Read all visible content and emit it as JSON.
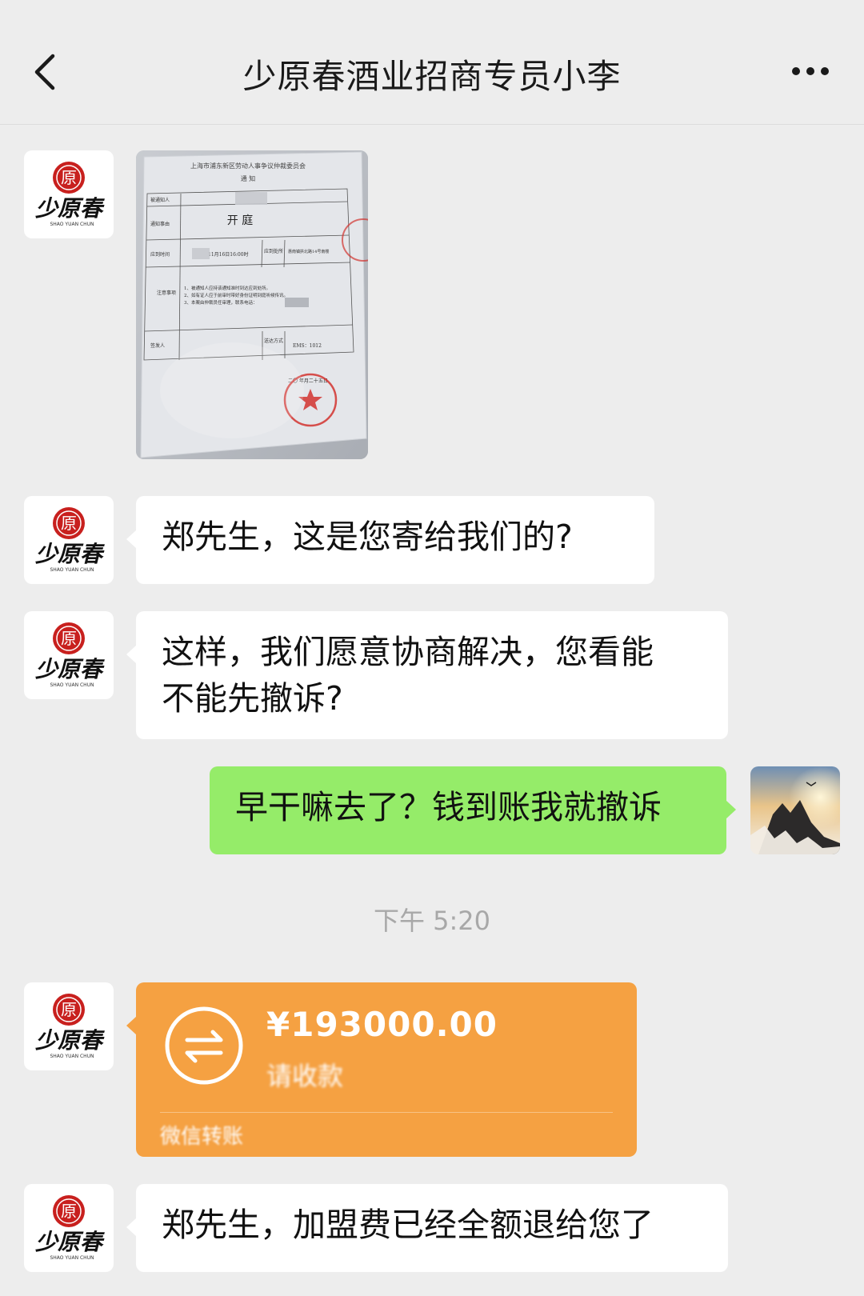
{
  "header": {
    "title": "少原春酒业招商专员小李"
  },
  "contact": {
    "avatar_logo_text": "少原春",
    "avatar_logo_pinyin": "SHAO YUAN CHUN",
    "avatar_seal_char": "原"
  },
  "photo": {
    "doc_title": "上海市浦东新区劳动人事争议仲裁委员会",
    "doc_subtitle": "通    知",
    "doc_heading": "开    庭",
    "rows": [
      "被通知人",
      "通知事由",
      "应到时间",
      "注意事项",
      "签发人"
    ],
    "note_lines": [
      "1、被通知人应持该通知准时到达应到处所。",
      "2、如有证人应于前审时带好身份证明到庭听候传讯。",
      "3、本案由仲裁员任审理，联系电话："
    ],
    "time_text": "11月16日16:00时",
    "place_label": "应到处所",
    "place_text": "惠南镇拱北路14号南楼",
    "delivery_label": "送达方式",
    "delivery_text": "EMS：1012",
    "date_text": "二〇   年月二十五日"
  },
  "messages": {
    "m1": "郑先生，这是您寄给我们的?",
    "m2_line1": "这样，我们愿意协商解决，您看能",
    "m2_line2": "不能先撤诉?",
    "m3": "早干嘛去了？钱到账我就撤诉",
    "time": "下午 5:20",
    "m5": "郑先生，加盟费已经全额退给您了"
  },
  "transfer": {
    "amount": "¥193000.00",
    "note": "请收款",
    "source": "微信转账",
    "color": "#f5a142"
  },
  "colors": {
    "background": "#ededed",
    "bubble_other": "#ffffff",
    "bubble_self": "#95ec69",
    "logo_red": "#c8201e"
  }
}
